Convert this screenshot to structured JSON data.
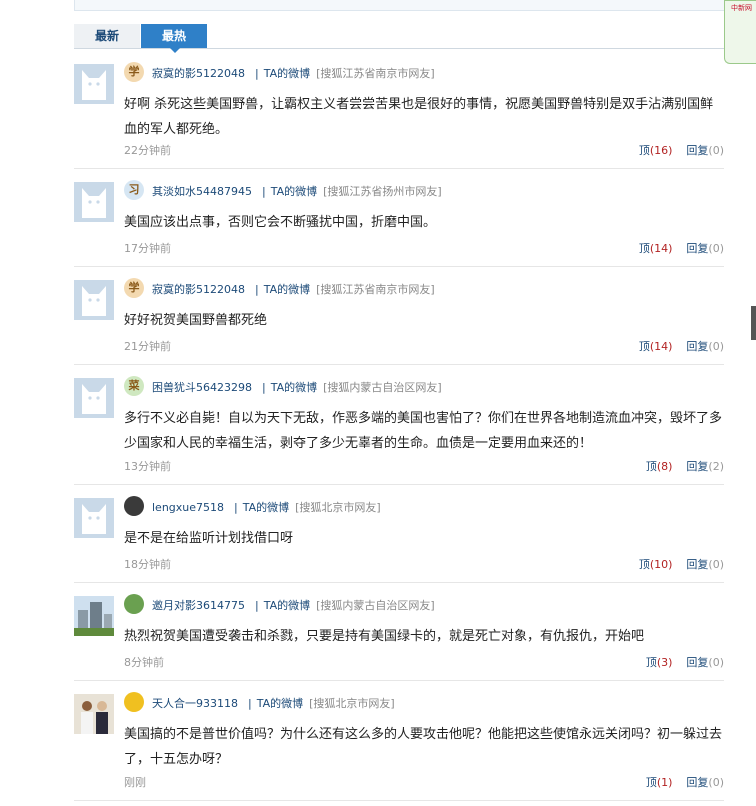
{
  "tabs": [
    {
      "label": "最新",
      "active": false
    },
    {
      "label": "最热",
      "active": true
    }
  ],
  "side_widget_text": "中新网",
  "weibo_label": "TA的微博",
  "up_label": "顶",
  "reply_label": "回复",
  "comments": [
    {
      "avatar": "cat-avatar",
      "badge": "学",
      "badge_color": "#f3d9b0",
      "username": "寂寞的影5122048",
      "location": "[搜狐江苏省南京市网友]",
      "text": "好啊 杀死这些美国野兽，让霸权主义者尝尝苦果也是很好的事情，祝愿美国野兽特别是双手沾满别国鲜血的军人都死绝。",
      "time": "22分钟前",
      "up_count": "(16)",
      "reply_count": "(0)"
    },
    {
      "avatar": "cat-avatar",
      "badge": "习",
      "badge_color": "#d6e6f3",
      "username": "其淡如水54487945",
      "location": "[搜狐江苏省扬州市网友]",
      "text": "美国应该出点事，否则它会不断骚扰中国，折磨中国。",
      "time": "17分钟前",
      "up_count": "(14)",
      "reply_count": "(0)"
    },
    {
      "avatar": "cat-avatar",
      "badge": "学",
      "badge_color": "#f3d9b0",
      "username": "寂寞的影5122048",
      "location": "[搜狐江苏省南京市网友]",
      "text": "好好祝贺美国野兽都死绝",
      "time": "21分钟前",
      "up_count": "(14)",
      "reply_count": "(0)"
    },
    {
      "avatar": "cat-avatar",
      "badge": "菜",
      "badge_color": "#cfe8c0",
      "username": "困兽犹斗56423298",
      "location": "[搜狐内蒙古自治区网友]",
      "text": "多行不义必自毙！自以为天下无敌，作恶多端的美国也害怕了？你们在世界各地制造流血冲突，毁坏了多少国家和人民的幸福生活，剥夺了多少无辜者的生命。血债是一定要用血来还的！",
      "time": "13分钟前",
      "up_count": "(8)",
      "reply_count": "(2)"
    },
    {
      "avatar": "cat-avatar",
      "badge": "",
      "badge_color": "#3a3a3a",
      "username": "lengxue7518",
      "location": "[搜狐北京市网友]",
      "text": "是不是在给监听计划找借口呀",
      "time": "18分钟前",
      "up_count": "(10)",
      "reply_count": "(0)"
    },
    {
      "avatar": "photo-avatar-building",
      "badge": "",
      "badge_color": "#6aa050",
      "username": "邀月对影3614775",
      "location": "[搜狐内蒙古自治区网友]",
      "text": "热烈祝贺美国遭受袭击和杀戮，只要是持有美国绿卡的，就是死亡对象，有仇报仇，开始吧",
      "time": "8分钟前",
      "up_count": "(3)",
      "reply_count": "(0)"
    },
    {
      "avatar": "photo-avatar-people",
      "badge": "",
      "badge_color": "#f0c020",
      "username": "天人合一933118",
      "location": "[搜狐北京市网友]",
      "text": "美国搞的不是普世价值吗？为什么还有这么多的人要攻击他呢？他能把这些使馆永远关闭吗？初一躲过去了，十五怎办呀？",
      "time": "刚刚",
      "up_count": "(1)",
      "reply_count": "(0)"
    }
  ]
}
